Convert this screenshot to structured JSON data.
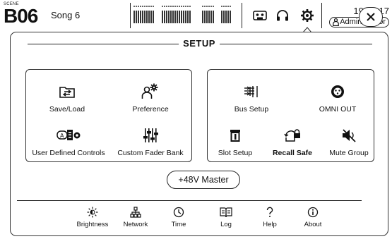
{
  "header": {
    "scene_tag": "SCENE",
    "scene_number": "B06",
    "scene_name": "Song 6",
    "time": "19:30:17",
    "user": "Administrator"
  },
  "icons": {
    "tape": "tape-icon",
    "headphones": "headphones-icon",
    "setup": "gear-icon",
    "close": "close-icon"
  },
  "setup": {
    "title": "SETUP",
    "left_group": {
      "save_load": "Save/Load",
      "preference": "Preference",
      "user_defined_controls": "User Defined Controls",
      "custom_fader_bank": "Custom Fader Bank"
    },
    "right_group": {
      "bus_setup": "Bus Setup",
      "omni_out": "OMNI OUT",
      "slot_setup": "Slot Setup",
      "recall_safe": "Recall Safe",
      "mute_group": "Mute Group"
    },
    "phantom_master": "+48V Master",
    "bottom": {
      "brightness": "Brightness",
      "network": "Network",
      "time": "Time",
      "log": "Log",
      "help": "Help",
      "about": "About"
    }
  }
}
